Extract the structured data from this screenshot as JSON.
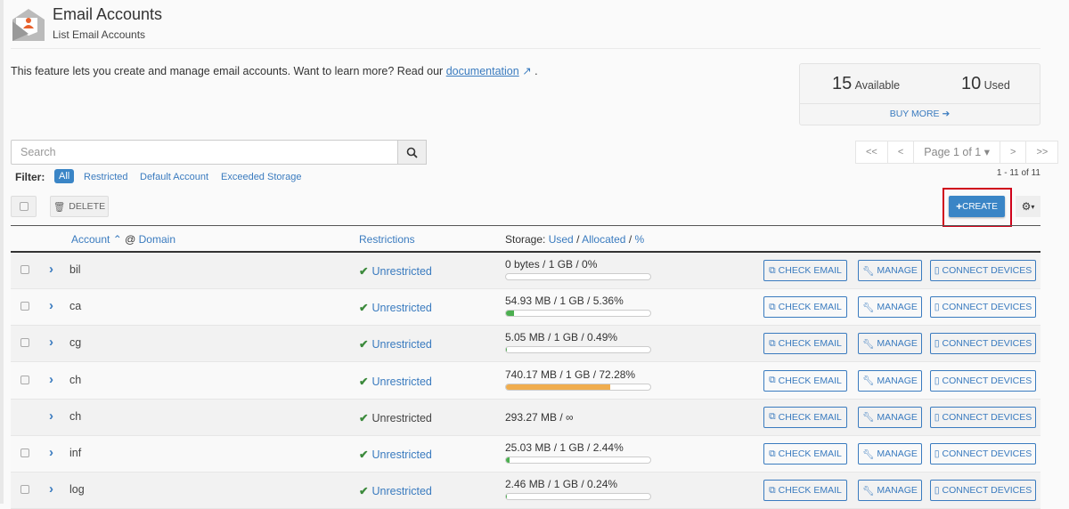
{
  "header": {
    "title": "Email Accounts",
    "subtitle": "List Email Accounts"
  },
  "intro": {
    "text": "This feature lets you create and manage email accounts. Want to learn more? Read our ",
    "link": "documentation",
    "suffix": "."
  },
  "stats": {
    "available_count": "15",
    "available_label": "Available",
    "used_count": "10",
    "used_label": "Used",
    "buy_more": "BUY MORE"
  },
  "search": {
    "placeholder": "Search"
  },
  "filter": {
    "label": "Filter:",
    "options": [
      "All",
      "Restricted",
      "Default Account",
      "Exceeded Storage"
    ],
    "active": "All"
  },
  "pager": {
    "first": "<<",
    "prev": "<",
    "page": "Page 1 of 1",
    "next": ">",
    "last": ">>",
    "count": "1 - 11 of 11"
  },
  "toolbar": {
    "delete": "DELETE",
    "create": "CREATE"
  },
  "table": {
    "headers": {
      "account": "Account",
      "at_domain": "@",
      "domain": "Domain",
      "restrictions": "Restrictions",
      "storage": "Storage:",
      "used": "Used",
      "allocated": "Allocated",
      "percent": "%",
      "sep": "/"
    },
    "actions": {
      "check": "CHECK EMAIL",
      "manage": "MANAGE",
      "connect": "CONNECT DEVICES"
    },
    "rows": [
      {
        "account": "bil",
        "restriction": "Unrestricted",
        "storage": "0 bytes / 1 GB / 0%",
        "percent": 0,
        "checkbox": true,
        "link": true
      },
      {
        "account": "ca",
        "restriction": "Unrestricted",
        "storage": "54.93 MB / 1 GB / 5.36%",
        "percent": 5.36,
        "checkbox": true,
        "link": true
      },
      {
        "account": "cg",
        "restriction": "Unrestricted",
        "storage": "5.05 MB / 1 GB / 0.49%",
        "percent": 0.49,
        "checkbox": true,
        "link": true
      },
      {
        "account": "ch",
        "restriction": "Unrestricted",
        "storage": "740.17 MB / 1 GB / 72.28%",
        "percent": 72.28,
        "checkbox": true,
        "link": true
      },
      {
        "account": "ch",
        "restriction": "Unrestricted",
        "storage": "293.27 MB / ∞",
        "percent": null,
        "checkbox": false,
        "link": false
      },
      {
        "account": "inf",
        "restriction": "Unrestricted",
        "storage": "25.03 MB / 1 GB / 2.44%",
        "percent": 2.44,
        "checkbox": true,
        "link": true
      },
      {
        "account": "log",
        "restriction": "Unrestricted",
        "storage": "2.46 MB / 1 GB / 0.24%",
        "percent": 0.24,
        "checkbox": true,
        "link": true
      }
    ]
  },
  "colors": {
    "accent": "#3a85c6",
    "ok": "#3c8a3c",
    "bar_green": "#4caf50",
    "bar_orange": "#f0ad4e",
    "highlight": "#d0021b"
  }
}
